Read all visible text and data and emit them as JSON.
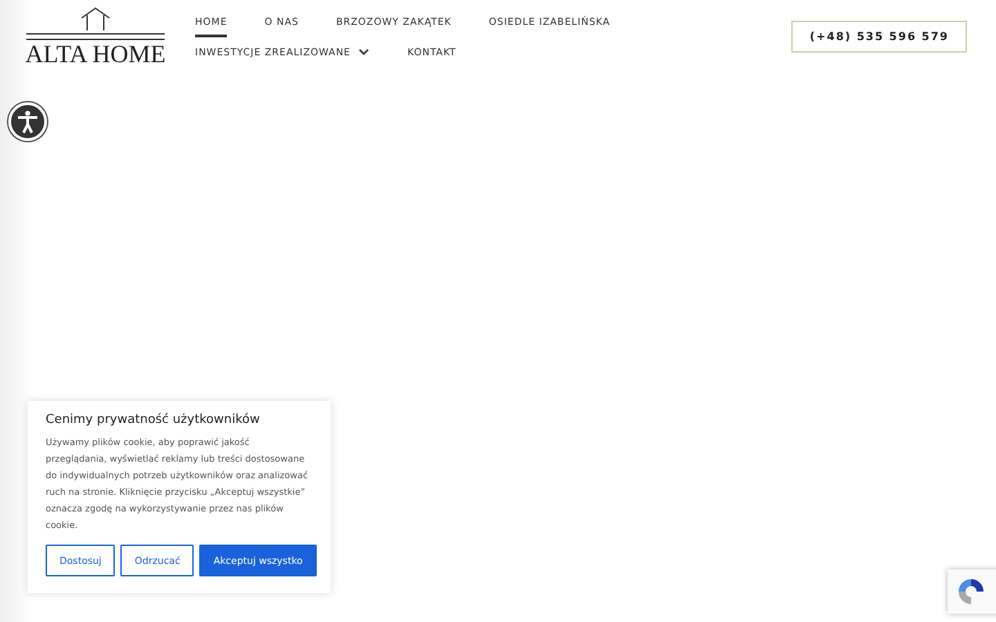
{
  "logo": {
    "text": "ALTA HOME"
  },
  "nav": [
    {
      "label": "HOME",
      "selected": true,
      "has_menu": false
    },
    {
      "label": "O NAS",
      "selected": false,
      "has_menu": false
    },
    {
      "label": "BRZOZOWY ZAKĄTEK",
      "selected": false,
      "has_menu": false
    },
    {
      "label": "OSIEDLE IZABELIŃSKA",
      "selected": false,
      "has_menu": false
    },
    {
      "label": "INWESTYCJE ZREALIZOWANE",
      "selected": false,
      "has_menu": true
    },
    {
      "label": "KONTAKT",
      "selected": false,
      "has_menu": false
    }
  ],
  "phone": "(+48) 535 596 579",
  "cookie_banner": {
    "title": "Cenimy prywatność użytkowników",
    "text": "Używamy plików cookie, aby poprawić jakość przeglądania, wyświetlać reklamy lub treści dostosowane do indywidualnych potrzeb użytkowników oraz analizować ruch na stronie. Kliknięcie przycisku „Akceptuj wszystkie” oznacza zgodę na wykorzystywanie przez nas plików cookie.",
    "buttons": [
      {
        "label": "Dostosuj",
        "kind": "outline"
      },
      {
        "label": "Odrzucać",
        "kind": "outline"
      },
      {
        "label": "Akceptuj wszystko",
        "kind": "primary"
      }
    ]
  }
}
